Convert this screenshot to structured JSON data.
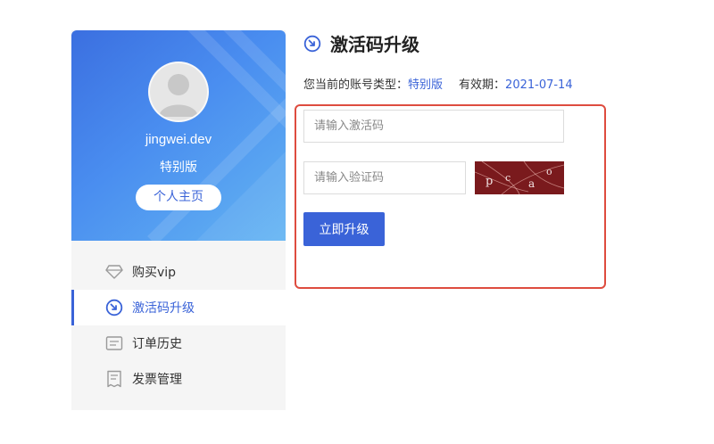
{
  "profile": {
    "username": "jingwei.dev",
    "account_type": "特别版",
    "profile_button_label": "个人主页"
  },
  "sidebar": {
    "items": [
      {
        "label": "购买vip",
        "icon": "diamond-icon",
        "active": false
      },
      {
        "label": "激活码升级",
        "icon": "upgrade-icon",
        "active": true
      },
      {
        "label": "订单历史",
        "icon": "order-history-icon",
        "active": false
      },
      {
        "label": "发票管理",
        "icon": "invoice-icon",
        "active": false
      }
    ]
  },
  "page": {
    "title": "激活码升级",
    "account_label": "您当前的账号类型：",
    "account_value": "特别版",
    "expiry_label": "有效期：",
    "expiry_value": "2021-07-14"
  },
  "form": {
    "code_placeholder": "请输入激活码",
    "captcha_placeholder": "请输入验证码",
    "captcha_text": "pcao",
    "submit_label": "立即升级"
  },
  "colors": {
    "accent": "#3a63d8",
    "highlight_border": "#de4c3f",
    "card_gradient_start": "#3b6fe0",
    "card_gradient_end": "#63b4f2",
    "captcha_bg": "#7a1a1d"
  }
}
